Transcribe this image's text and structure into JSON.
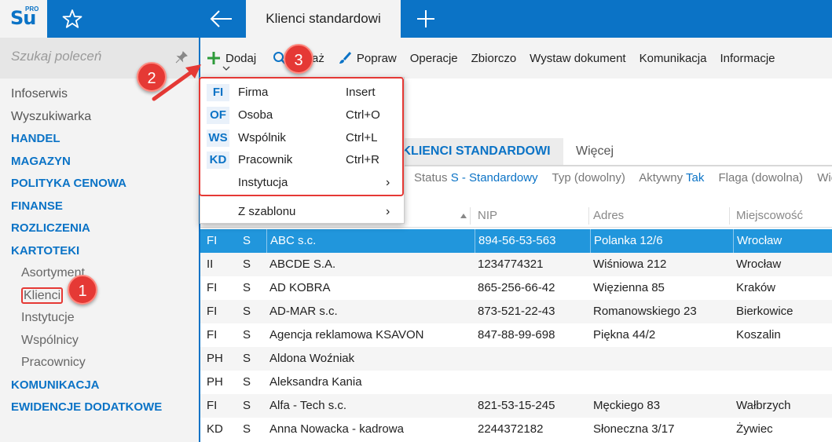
{
  "topbar": {
    "logo_text": "Su",
    "logo_sup": "PRO",
    "active_tab": "Klienci standardowi"
  },
  "sidebar": {
    "search_placeholder": "Szukaj poleceń",
    "items": [
      {
        "label": "Infoserwis",
        "kind": "plain"
      },
      {
        "label": "Wyszukiwarka",
        "kind": "plain"
      },
      {
        "label": "HANDEL",
        "kind": "cat"
      },
      {
        "label": "MAGAZYN",
        "kind": "cat"
      },
      {
        "label": "POLITYKA CENOWA",
        "kind": "cat"
      },
      {
        "label": "FINANSE",
        "kind": "cat"
      },
      {
        "label": "ROZLICZENIA",
        "kind": "cat"
      },
      {
        "label": "KARTOTEKI",
        "kind": "cat"
      },
      {
        "label": "Asortyment",
        "kind": "sub"
      },
      {
        "label": "Klienci",
        "kind": "sub"
      },
      {
        "label": "Instytucje",
        "kind": "sub"
      },
      {
        "label": "Wspólnicy",
        "kind": "sub"
      },
      {
        "label": "Pracownicy",
        "kind": "sub"
      },
      {
        "label": "KOMUNIKACJA",
        "kind": "cat"
      },
      {
        "label": "EWIDENCJE DODATKOWE",
        "kind": "cat"
      }
    ]
  },
  "toolbar": {
    "dodaj": "Dodaj",
    "pokaz": "Pokaż",
    "popraw": "Popraw",
    "operacje": "Operacje",
    "zbiorczo": "Zbiorczo",
    "wystaw": "Wystaw dokument",
    "komunikacja": "Komunikacja",
    "informacje": "Informacje"
  },
  "dropdown": {
    "items": [
      {
        "code": "FI",
        "label": "Firma",
        "shortcut": "Insert"
      },
      {
        "code": "OF",
        "label": "Osoba",
        "shortcut": "Ctrl+O"
      },
      {
        "code": "WS",
        "label": "Wspólnik",
        "shortcut": "Ctrl+L"
      },
      {
        "code": "KD",
        "label": "Pracownik",
        "shortcut": "Ctrl+R"
      },
      {
        "code": "",
        "label": "Instytucja",
        "shortcut": ""
      },
      {
        "code": "",
        "label": "Z szablonu",
        "shortcut": ""
      }
    ],
    "submenu_arrow": "›"
  },
  "tabs": {
    "active": "KLIENCI STANDARDOWI",
    "more": "Więcej"
  },
  "filters": {
    "status_label": "Status",
    "status_value": "S - Standardowy",
    "typ": "Typ (dowolny)",
    "aktywny_label": "Aktywny",
    "aktywny_value": "Tak",
    "flaga": "Flaga (dowolna)",
    "cut": "Wie"
  },
  "table": {
    "columns": [
      "NIP",
      "Adres",
      "Miejscowość"
    ],
    "rows": [
      [
        "FI",
        "S",
        "ABC s.c.",
        "894-56-53-563",
        "Polanka  12/6",
        "Wrocław"
      ],
      [
        "II",
        "S",
        "ABCDE S.A.",
        "1234774321",
        "Wiśniowa 212",
        "Wrocław"
      ],
      [
        "FI",
        "S",
        "AD KOBRA",
        "865-256-66-42",
        "Więzienna  85",
        "Kraków"
      ],
      [
        "FI",
        "S",
        "AD-MAR s.c.",
        "873-521-22-43",
        "Romanowskiego 23",
        "Bierkowice"
      ],
      [
        "FI",
        "S",
        "Agencja reklamowa KSAVON",
        "847-88-99-698",
        "Piękna  44/2",
        "Koszalin"
      ],
      [
        "PH",
        "S",
        "Aldona Woźniak",
        "",
        "",
        ""
      ],
      [
        "PH",
        "S",
        "Aleksandra Kania",
        "",
        "",
        ""
      ],
      [
        "FI",
        "S",
        "Alfa - Tech s.c.",
        "821-53-15-245",
        "Męckiego  83",
        "Wałbrzych"
      ],
      [
        "KD",
        "S",
        "Anna Nowacka - kadrowa",
        "2244372182",
        "Słoneczna 3/17",
        "Żywiec"
      ]
    ]
  },
  "badges": [
    "1",
    "2",
    "3"
  ],
  "colors": {
    "accent": "#0b73c6",
    "selection": "#2196dc",
    "badge": "#e53935"
  }
}
